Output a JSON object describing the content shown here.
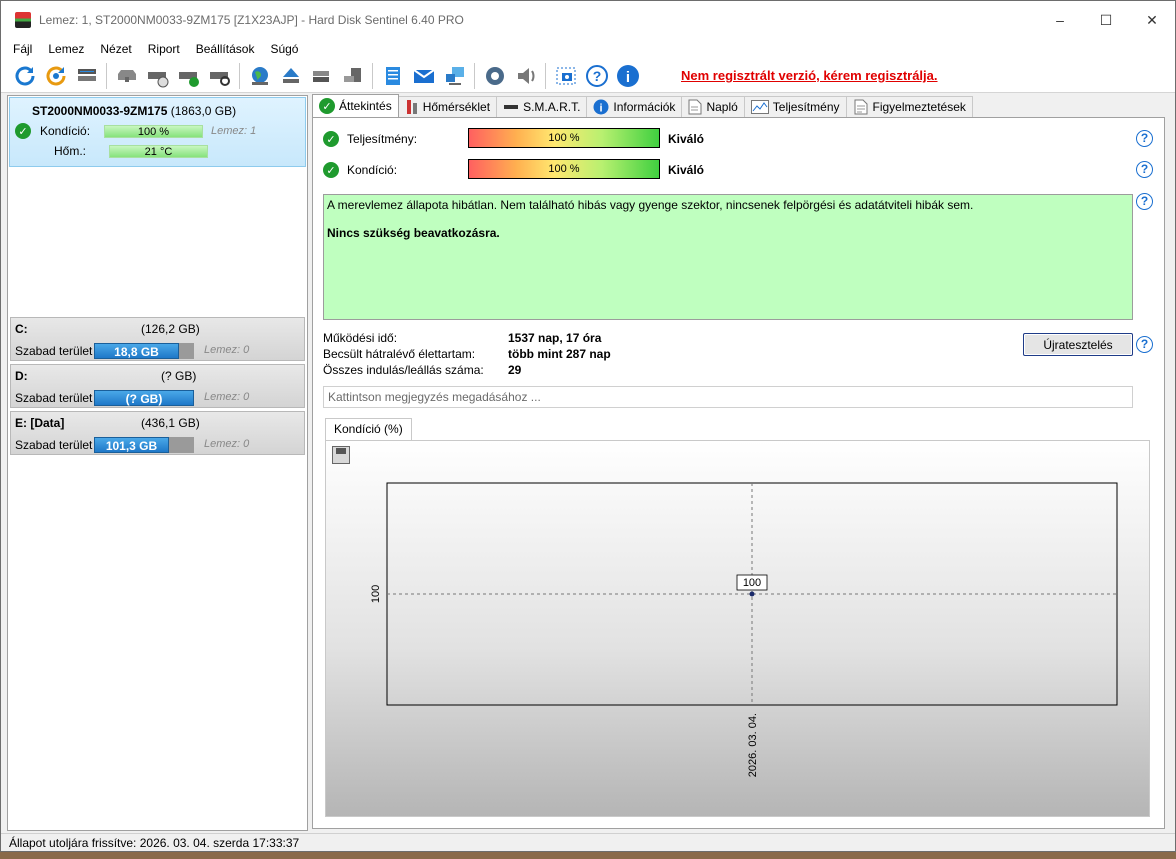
{
  "window": {
    "title": "Lemez: 1, ST2000NM0033-9ZM175 [Z1X23AJP]  -  Hard Disk Sentinel 6.40 PRO"
  },
  "menu": [
    {
      "label": "Fájl"
    },
    {
      "label": "Lemez"
    },
    {
      "label": "Nézet"
    },
    {
      "label": "Riport"
    },
    {
      "label": "Beállítások"
    },
    {
      "label": "Súgó"
    }
  ],
  "toolbar": {
    "icons": [
      "refresh-icon",
      "refresh-all-icon",
      "disk-icon",
      "disk-gray-icon",
      "disk-clock-icon",
      "disk-check-icon",
      "disk-search-icon",
      "globe-icon",
      "eject-icon",
      "server-icon",
      "server-alt-icon",
      "notes-icon",
      "mail-icon",
      "network-icon",
      "gear-icon",
      "speaker-icon",
      "screenshot-icon",
      "help-icon",
      "info-icon"
    ],
    "unregistered": "Nem regisztrált verzió, kérem regisztrálja."
  },
  "disk": {
    "name": "ST2000NM0033-9ZM175",
    "size": "(1863,0 GB)",
    "condition_label": "Kondíció:",
    "condition_value": "100 %",
    "condition_fraction": 1.0,
    "disk_label": "Lemez: 1",
    "temp_label": "Hőm.:",
    "temp_value": "21 °C"
  },
  "volumes": [
    {
      "letter": "C:",
      "size": "(126,2 GB)",
      "free_label": "Szabad terület",
      "free_value": "18,8 GB",
      "free_fraction": 0.85,
      "errors": "Lemez: 0"
    },
    {
      "letter": "D:",
      "size": "(? GB)",
      "free_label": "Szabad terület",
      "free_value": "(? GB)",
      "free_fraction": 1.0,
      "errors": "Lemez: 0"
    },
    {
      "letter": "E: [Data]",
      "size": "(436,1 GB)",
      "free_label": "Szabad terület",
      "free_value": "101,3 GB",
      "free_fraction": 0.75,
      "errors": "Lemez: 0"
    }
  ],
  "tabs": [
    {
      "label": "Áttekintés",
      "icon": "check-icon",
      "active": true
    },
    {
      "label": "Hőmérséklet",
      "icon": "thermometer-icon"
    },
    {
      "label": "S.M.A.R.T.",
      "icon": "disk-icon"
    },
    {
      "label": "Információk",
      "icon": "info-icon"
    },
    {
      "label": "Napló",
      "icon": "document-icon"
    },
    {
      "label": "Teljesítmény",
      "icon": "chart-icon"
    },
    {
      "label": "Figyelmeztetések",
      "icon": "warning-list-icon"
    }
  ],
  "overview": {
    "performance": {
      "label": "Teljesítmény:",
      "value": "100 %",
      "rating": "Kiváló"
    },
    "health": {
      "label": "Kondíció:",
      "value": "100 %",
      "rating": "Kiváló"
    },
    "summary_text": "A merevlemez állapota hibátlan. Nem található hibás vagy gyenge szektor, nincsenek felpörgési és adatátviteli hibák sem.",
    "summary_action": "Nincs szükség beavatkozásra.",
    "power_on_label": "Működési idő:",
    "power_on_value": "1537 nap, 17 óra",
    "lifetime_label": "Becsült hátralévő élettartam:",
    "lifetime_value": "több mint 287 nap",
    "startstop_label": "Összes indulás/leállás száma:",
    "startstop_value": "29",
    "retest_button": "Újratesztelés",
    "note_placeholder": "Kattintson megjegyzés megadásához ...",
    "chart_tab": "Kondíció  (%)"
  },
  "chart_data": {
    "type": "line",
    "x": [
      "2026. 03. 04."
    ],
    "series": [
      {
        "values": [
          100
        ]
      }
    ],
    "tick_label_y": "100",
    "tick_label_x": "2026. 03. 04.",
    "data_label": "100",
    "grid": true
  },
  "statusbar": {
    "text": "Állapot utoljára frissítve: 2026. 03. 04. szerda 17:33:37"
  },
  "colors": {
    "unregistered": "#e00000",
    "summary_bg": "#bfffbf",
    "selected_disk": "#c8e8fb",
    "volume_bar": "#1e78c8"
  }
}
